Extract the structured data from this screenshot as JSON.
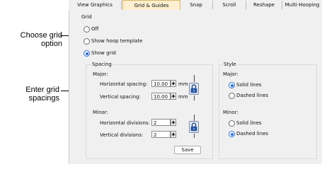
{
  "callouts": {
    "choose_grid": "Choose grid option",
    "enter_spacings": "Enter grid spacings"
  },
  "tabs": [
    "View Graphics",
    "Grid & Guides",
    "Snap",
    "Scroll",
    "Reshape",
    "Multi-Hooping"
  ],
  "active_tab": "Grid & Guides",
  "grid": {
    "title": "Grid",
    "options": [
      "Off",
      "Show hoop template",
      "Show grid"
    ],
    "selected": "Show grid"
  },
  "spacing": {
    "title": "Spacing",
    "major_title": "Major:",
    "horizontal_label": "Horizontal spacing:",
    "horizontal_value": "10.00",
    "horizontal_unit": "mm",
    "vertical_label": "Vertical spacing:",
    "vertical_value": "10.00",
    "vertical_unit": "mm",
    "minor_title": "Minor:",
    "h_div_label": "Horizontal divisions:",
    "h_div_value": "2",
    "v_div_label": "Vertical divisions:",
    "v_div_value": "2",
    "save_label": "Save"
  },
  "style": {
    "title": "Style",
    "major_title": "Major:",
    "major_options": [
      "Solid lines",
      "Dashed lines"
    ],
    "major_selected": "Solid lines",
    "minor_title": "Minor:",
    "minor_options": [
      "Solid lines",
      "Dashed lines"
    ],
    "minor_selected": "Dashed lines"
  },
  "icons": {
    "lock": "padlock-icon"
  }
}
